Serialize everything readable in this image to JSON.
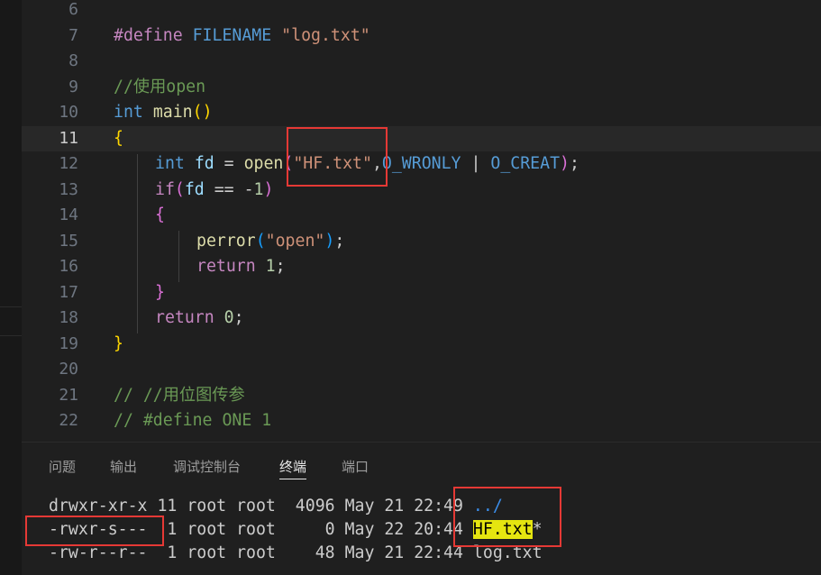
{
  "editor": {
    "lines": [
      {
        "num": "6"
      },
      {
        "num": "7",
        "t1": "#define",
        "t2": " FILENAME",
        "t3": " ",
        "t4": "\"log.txt\""
      },
      {
        "num": "8"
      },
      {
        "num": "9",
        "t1": "//使用open"
      },
      {
        "num": "10",
        "t1": "int",
        "t2": " ",
        "t3": "main",
        "t4": "()"
      },
      {
        "num": "11",
        "t1": "{"
      },
      {
        "num": "12",
        "t1": "int",
        "t2": " ",
        "t3": "fd",
        "t4": " = ",
        "t5": "open",
        "t6": "(",
        "t7": "\"HF.txt\"",
        "t8": ",",
        "t9": "O_WRONLY",
        "t10": " | ",
        "t11": "O_CREAT",
        "t12": ")",
        "t13": ";"
      },
      {
        "num": "13",
        "t1": "if",
        "t2": "(",
        "t3": "fd",
        "t4": " == -",
        "t5": "1",
        "t6": ")"
      },
      {
        "num": "14",
        "t1": "{"
      },
      {
        "num": "15",
        "t1": "perror",
        "t2": "(",
        "t3": "\"open\"",
        "t4": ")",
        "t5": ";"
      },
      {
        "num": "16",
        "t1": "return",
        "t2": " ",
        "t3": "1",
        "t4": ";"
      },
      {
        "num": "17",
        "t1": "}"
      },
      {
        "num": "18",
        "t1": "return",
        "t2": " ",
        "t3": "0",
        "t4": ";"
      },
      {
        "num": "19",
        "t1": "}"
      },
      {
        "num": "20"
      },
      {
        "num": "21",
        "t1": "// //用位图传参"
      },
      {
        "num": "22",
        "t1": "// #define ONE 1"
      }
    ]
  },
  "panel": {
    "tabs": [
      "问题",
      "输出",
      "调试控制台",
      "终端",
      "端口"
    ],
    "active_tab": "终端"
  },
  "terminal": {
    "rows": [
      {
        "perms": "drwxr-xr-x",
        "links": "11",
        "owner": "root",
        "group": "root",
        "size": "4096",
        "date": "May 21 22:49",
        "name": "../",
        "suffix": ""
      },
      {
        "perms": "-rwxr-s---",
        "links": "1",
        "owner": "root",
        "group": "root",
        "size": "0",
        "date": "May 22 20:44",
        "name": "HF.txt",
        "suffix": "*"
      },
      {
        "perms": "-rw-r--r--",
        "links": "1",
        "owner": "root",
        "group": "root",
        "size": "48",
        "date": "May 21 22:44",
        "name": "log.txt",
        "suffix": ""
      }
    ]
  },
  "colors": {
    "annotation_box": "#e53935",
    "file_highlight": "#e5e510",
    "directory": "#3b8eea"
  }
}
